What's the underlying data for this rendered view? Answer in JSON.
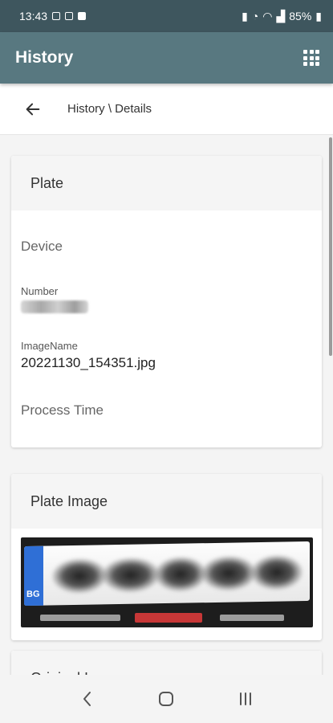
{
  "status_bar": {
    "time": "13:43",
    "battery": "85%"
  },
  "app_bar": {
    "title": "History",
    "menu_icon": "apps-grid-icon"
  },
  "breadcrumb": {
    "text": "History \\ Details",
    "back_icon": "arrow-left-icon"
  },
  "plate_card": {
    "header": "Plate",
    "device_label": "Device",
    "number_label": "Number",
    "image_name_label": "ImageName",
    "image_name_value": "20221130_154351.jpg",
    "process_time_label": "Process Time"
  },
  "plate_image_card": {
    "header": "Plate Image",
    "plate_country": "BG"
  },
  "original_image_card": {
    "header": "Original Image"
  },
  "colors": {
    "app_bar": "#587880",
    "status_bar": "#3e565e",
    "eu_blue": "#2f6fd6"
  }
}
